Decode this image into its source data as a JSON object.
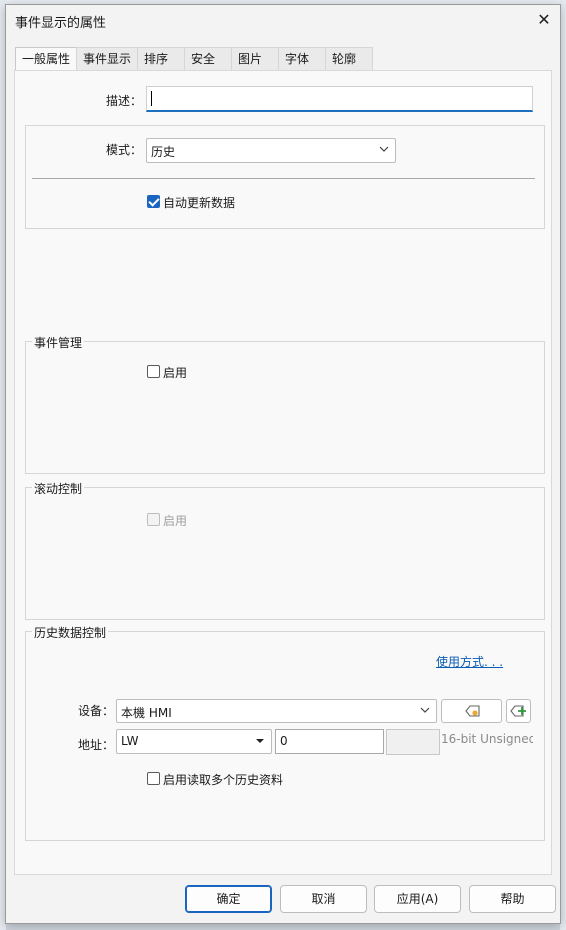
{
  "dialog": {
    "title": "事件显示的属性",
    "close_glyph": "✕"
  },
  "tabs": [
    {
      "label": "一般属性",
      "active": true
    },
    {
      "label": "事件显示",
      "active": false
    },
    {
      "label": "排序",
      "active": false
    },
    {
      "label": "安全",
      "active": false
    },
    {
      "label": "图片",
      "active": false
    },
    {
      "label": "字体",
      "active": false
    },
    {
      "label": "轮廓",
      "active": false
    }
  ],
  "general": {
    "description_label": "描述：",
    "description_value": "",
    "mode_label": "模式：",
    "mode_value": "历史",
    "auto_update_label": "自动更新数据",
    "auto_update_checked": true
  },
  "event_management": {
    "title": "事件管理",
    "enable_label": "启用",
    "enable_checked": false
  },
  "scroll_control": {
    "title": "滚动控制",
    "enable_label": "启用",
    "enable_checked": false,
    "disabled": true
  },
  "history_control": {
    "title": "历史数据控制",
    "usage_link": "使用方式. . .",
    "device_label": "设备：",
    "device_value": "本機 HMI",
    "address_label": "地址：",
    "address_type": "LW",
    "address_value": "0",
    "format_text": "16-bit Unsigned",
    "multi_read_label": "启用读取多个历史资料",
    "multi_read_checked": false
  },
  "buttons": {
    "ok": "确定",
    "cancel": "取消",
    "apply": "应用(A)",
    "help": "帮助"
  },
  "colors": {
    "accent": "#1a65c0",
    "link": "#0a5bb5"
  },
  "icons": {
    "close": "close-icon",
    "dropdown": "chevron-down-icon",
    "tag": "tag-icon",
    "add_tag": "add-tag-icon"
  }
}
